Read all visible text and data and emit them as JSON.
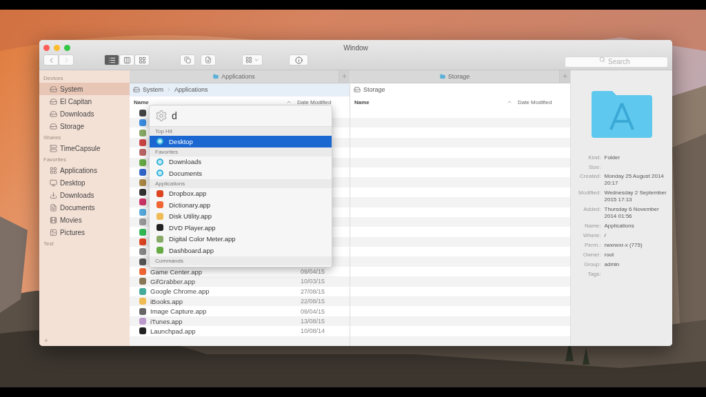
{
  "window": {
    "title": "Window"
  },
  "toolbar": {
    "view_modes": [
      {
        "kind": "list",
        "selected": true
      },
      {
        "kind": "columns",
        "selected": false
      },
      {
        "kind": "icons",
        "selected": false
      }
    ],
    "search": {
      "placeholder": "Search"
    }
  },
  "sidebar": {
    "sections": [
      {
        "title": "Devices",
        "items": [
          {
            "label": "System",
            "kind": "disk",
            "selected": true
          },
          {
            "label": "El Capitan",
            "kind": "disk",
            "selected": false
          },
          {
            "label": "Downloads",
            "kind": "disk",
            "selected": false
          },
          {
            "label": "Storage",
            "kind": "disk",
            "selected": false
          }
        ]
      },
      {
        "title": "Shares",
        "items": [
          {
            "label": "TimeCapsule",
            "kind": "server",
            "selected": false
          }
        ]
      },
      {
        "title": "Favorites",
        "items": [
          {
            "label": "Applications",
            "kind": "apps",
            "selected": false
          },
          {
            "label": "Desktop",
            "kind": "desktop",
            "selected": false
          },
          {
            "label": "Downloads",
            "kind": "download",
            "selected": false
          },
          {
            "label": "Documents",
            "kind": "document",
            "selected": false
          },
          {
            "label": "Movies",
            "kind": "movie",
            "selected": false
          },
          {
            "label": "Pictures",
            "kind": "picture",
            "selected": false
          }
        ]
      },
      {
        "title": "Test"
      }
    ]
  },
  "panes": [
    {
      "tab": "Applications",
      "active": true,
      "path": [
        "System",
        "Applications"
      ],
      "columns": [
        "Name",
        "Date Modified"
      ],
      "rows": [
        {
          "kind": "covered"
        },
        {
          "kind": "covered"
        },
        {
          "kind": "covered"
        },
        {
          "kind": "covered"
        },
        {
          "kind": "covered"
        },
        {
          "kind": "covered"
        },
        {
          "kind": "covered"
        },
        {
          "kind": "covered"
        },
        {
          "kind": "covered"
        },
        {
          "kind": "covered"
        },
        {
          "kind": "covered"
        },
        {
          "kind": "covered"
        },
        {
          "kind": "covered"
        },
        {
          "kind": "covered"
        },
        {
          "kind": "covered"
        },
        {
          "kind": "covered"
        },
        {
          "kind": "file",
          "name": "Game Center.app",
          "date": "09/04/15"
        },
        {
          "kind": "file",
          "name": "GifGrabber.app",
          "date": "10/03/15"
        },
        {
          "kind": "file",
          "name": "Google Chrome.app",
          "date": "27/08/15"
        },
        {
          "kind": "file",
          "name": "iBooks.app",
          "date": "22/08/15"
        },
        {
          "kind": "file",
          "name": "Image Capture.app",
          "date": "09/04/15"
        },
        {
          "kind": "file",
          "name": "iTunes.app",
          "date": "13/08/15"
        },
        {
          "kind": "file",
          "name": "Launchpad.app",
          "date": "10/08/14"
        }
      ],
      "popup": {
        "query": "d",
        "sections": [
          {
            "title": "Top Hit",
            "items": [
              {
                "label": "Desktop",
                "kind": "folder",
                "selected": true
              }
            ]
          },
          {
            "title": "Favorites",
            "items": [
              {
                "label": "Downloads",
                "kind": "folder",
                "selected": false
              },
              {
                "label": "Documents",
                "kind": "folder",
                "selected": false
              }
            ]
          },
          {
            "title": "Applications",
            "items": [
              {
                "label": "Dropbox.app",
                "kind": "app",
                "selected": false
              },
              {
                "label": "Dictionary.app",
                "kind": "app",
                "selected": false
              },
              {
                "label": "Disk Utility.app",
                "kind": "app",
                "selected": false
              },
              {
                "label": "DVD Player.app",
                "kind": "app",
                "selected": false
              },
              {
                "label": "Digital Color Meter.app",
                "kind": "app",
                "selected": false
              },
              {
                "label": "Dashboard.app",
                "kind": "app",
                "selected": false
              }
            ]
          },
          {
            "title": "Commands"
          }
        ]
      }
    },
    {
      "tab": "Storage",
      "active": false,
      "path": [
        "Storage"
      ],
      "columns": [
        "Name",
        "Date Modified"
      ]
    }
  ],
  "inspector": {
    "fields": [
      {
        "label": "Kind:",
        "value": "Folder"
      },
      {
        "label": "Size:"
      },
      {
        "label": "Created:",
        "value": "Monday 25 August 2014 20:17"
      },
      {
        "label": "Modified:",
        "value": "Wednesday 2 September 2015 17:13"
      },
      {
        "label": "Added:",
        "value": "Thursday 6 November 2014 01:56"
      },
      {
        "label": "Name:",
        "value": "Applications"
      },
      {
        "label": "Where:",
        "value": "/"
      },
      {
        "label": "Perm.:",
        "value": "rwxrwxr-x (775)"
      },
      {
        "label": "Owner:",
        "value": "root"
      },
      {
        "label": "Group:",
        "value": "admin"
      },
      {
        "label": "Tags:"
      }
    ]
  }
}
